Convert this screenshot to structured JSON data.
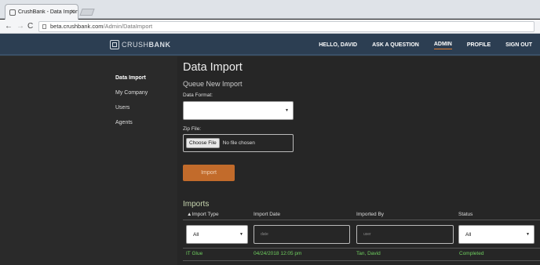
{
  "browser": {
    "tab_title": "CrushBank - Data Import",
    "tab_close": "×",
    "nav_back": "←",
    "nav_forward": "→",
    "nav_reload": "C",
    "url_host": "beta.crushbank.com",
    "url_path": "/Admin/DataImport"
  },
  "header": {
    "logo_light": "CRUSH",
    "logo_bold": "BANK",
    "nav": [
      "HELLO, DAVID",
      "ASK A QUESTION",
      "ADMIN",
      "PROFILE",
      "SIGN OUT"
    ],
    "active_nav": "ADMIN"
  },
  "sidebar": {
    "items": [
      {
        "label": "Data Import",
        "current": true
      },
      {
        "label": "My Company",
        "current": false
      },
      {
        "label": "Users",
        "current": false
      },
      {
        "label": "Agents",
        "current": false
      }
    ]
  },
  "main": {
    "title": "Data Import",
    "section_title": "Queue New Import",
    "data_format_label": "Data Format:",
    "data_format_value": "",
    "zip_file_label": "Zip File:",
    "choose_file_label": "Choose File",
    "file_status": "No file chosen",
    "import_button": "Import"
  },
  "imports": {
    "title": "Imports",
    "columns": [
      "▲Import Type",
      "Import Date",
      "Imported By",
      "Status"
    ],
    "filters": {
      "type_value": "All",
      "date_placeholder": "date",
      "user_placeholder": "user",
      "status_value": "All"
    },
    "rows": [
      {
        "type": "IT Glue",
        "date": "04/24/2018 12:05 pm",
        "by": "Tan, David",
        "status": "Completed"
      }
    ]
  },
  "colors": {
    "header_bg": "#2c3e52",
    "accent": "#c26b2b",
    "row_text": "#6fcf5f"
  }
}
